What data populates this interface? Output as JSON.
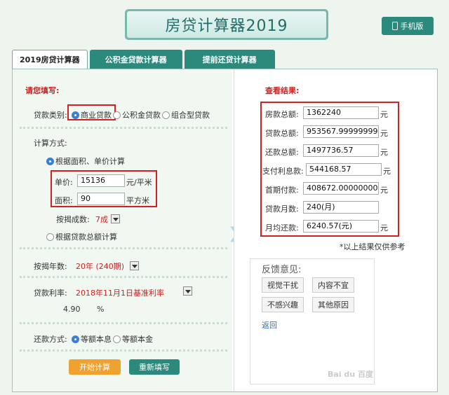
{
  "header": {
    "title": "房贷计算器2019",
    "mobile_label": "手机版"
  },
  "tabs": [
    "2019房贷计算器",
    "公积金贷款计算器",
    "提前还贷计算器"
  ],
  "form": {
    "section_title": "请您填写:",
    "loan_type_label": "贷款类别:",
    "loan_types": [
      "商业贷款",
      "公积金贷款",
      "组合型贷款"
    ],
    "method_label": "计算方式:",
    "method_area": "根据面积、单价计算",
    "unit_price_label": "单价:",
    "unit_price": "15136",
    "unit_price_unit": "元/平米",
    "area_label": "面积:",
    "area": "90",
    "area_unit": "平方米",
    "ratio_label": "按揭成数:",
    "ratio": "7成",
    "method_total": "根据贷款总额计算",
    "years_label": "按揭年数:",
    "years": "20年 (240期)",
    "rate_label": "贷款利率:",
    "rate_option": "2018年11月1日基准利率",
    "rate_value": "4.90",
    "rate_unit": "%",
    "repay_label": "还款方式:",
    "repay_types": [
      "等额本息",
      "等额本金"
    ],
    "calc_button": "开始计算",
    "reset_button": "重新填写"
  },
  "results": {
    "section_title": "查看结果:",
    "rows": [
      {
        "label": "房款总额:",
        "value": "1362240",
        "unit": "元"
      },
      {
        "label": "贷款总额:",
        "value": "953567.9999999999",
        "unit": "元"
      },
      {
        "label": "还款总额:",
        "value": "1497736.57",
        "unit": "元"
      },
      {
        "label": "支付利息款:",
        "value": "544168.57",
        "unit": "元"
      },
      {
        "label": "首期付款:",
        "value": "408672.0000000001",
        "unit": "元"
      },
      {
        "label": "贷款月数:",
        "value": "240(月)",
        "unit": ""
      },
      {
        "label": "月均还款:",
        "value": "6240.57(元)",
        "unit": "元"
      }
    ],
    "note": "*以上结果仅供参考"
  },
  "feedback": {
    "title": "反馈意见:",
    "options": [
      "视觉干扰",
      "内容不宜",
      "不感兴趣",
      "其他原因"
    ],
    "back_link": "返回",
    "watermark": "Bai du 百度"
  }
}
